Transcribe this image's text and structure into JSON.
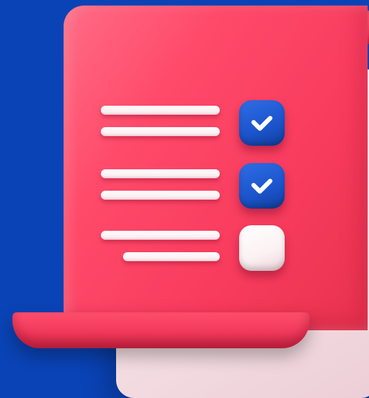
{
  "colors": {
    "background": "#0a43b5",
    "sheet": "#f83c5e",
    "back_card": "#f7e3e7",
    "check_blue": "#1b54cc",
    "check_mark": "#ffffff"
  },
  "checklist": {
    "items": [
      {
        "checked": true,
        "icon": "checkmark-icon"
      },
      {
        "checked": true,
        "icon": "checkmark-icon"
      },
      {
        "checked": false,
        "icon": "empty-checkbox-icon"
      }
    ]
  }
}
